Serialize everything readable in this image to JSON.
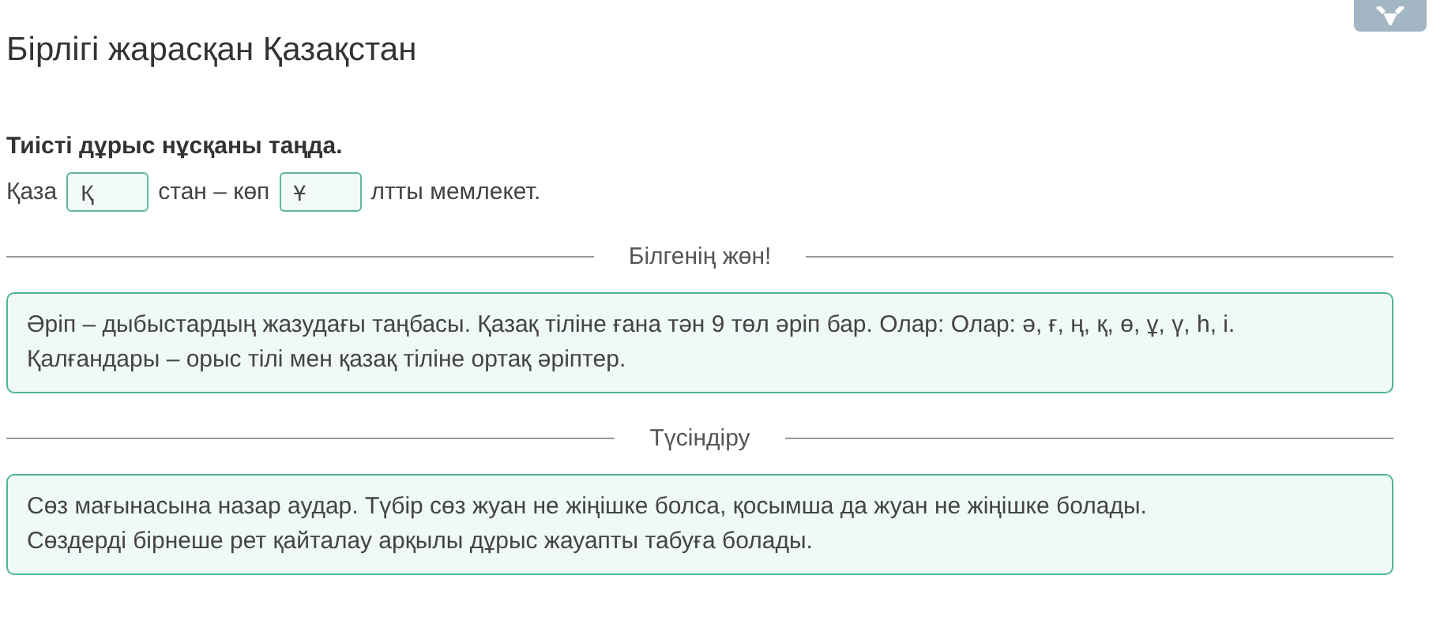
{
  "title": "Бірлігі жарасқан Қазақстан",
  "instruction": "Тиісті дұрыс нұсқаны таңда.",
  "sentence": [
    {
      "kind": "text",
      "text": "Қаза"
    },
    {
      "kind": "blank",
      "value": "Қ"
    },
    {
      "kind": "text",
      "text": "стан – көп"
    },
    {
      "kind": "blank",
      "value": "Ұ"
    },
    {
      "kind": "text",
      "text": "лтты мемлекет."
    }
  ],
  "sections": [
    {
      "heading": "Білгенің жөн!",
      "lines": [
        "Әріп – дыбыстардың жазудағы таңбасы. Қазақ тіліне ғана тән 9 төл әріп бар. Олар: Олар: ә, ғ, ң, қ, ө, ұ, ү, һ, і.",
        "Қалғандары – орыс тілі мен қазақ тіліне ортақ әріптер."
      ]
    },
    {
      "heading": "Түсіндіру",
      "lines": [
        "Сөз мағынасына назар аудар. Түбір сөз жуан не жіңішке болса, қосымша да жуан не жіңішке болады.",
        "Сөздерді бірнеше рет қайталау арқылы дұрыс жауапты табуға болады."
      ]
    }
  ]
}
